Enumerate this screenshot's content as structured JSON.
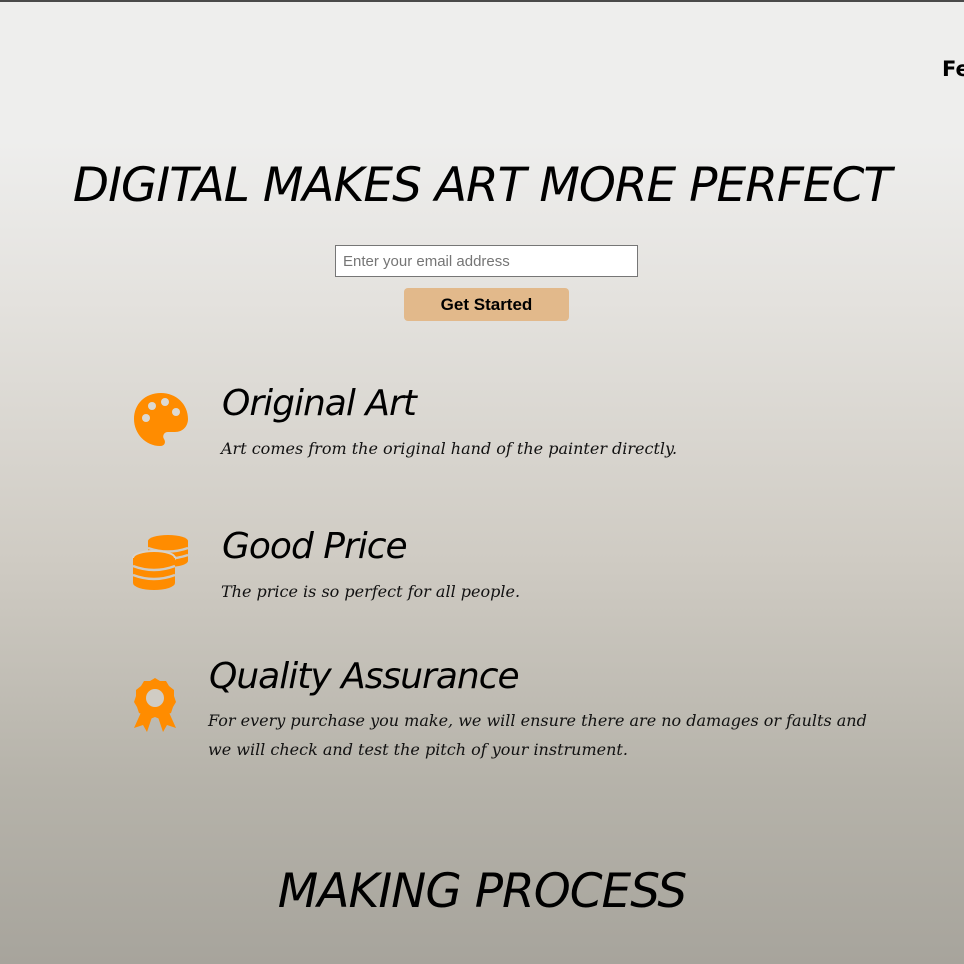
{
  "nav": {
    "features_label": "Fe"
  },
  "hero": {
    "title": "DIGITAL MAKES ART MORE PERFECT",
    "email_placeholder": "Enter your email address",
    "cta_label": "Get Started"
  },
  "features": [
    {
      "icon": "palette-icon",
      "title": "Original Art",
      "description": "Art comes from the original hand of the painter directly."
    },
    {
      "icon": "coins-icon",
      "title": "Good Price",
      "description": "The price is so perfect for all people."
    },
    {
      "icon": "award-icon",
      "title": "Quality Assurance",
      "description": "For every purchase you make, we will ensure there are no damages or faults and we will check and test the pitch of your instrument."
    }
  ],
  "process": {
    "title": "MAKING PROCESS"
  },
  "colors": {
    "accent": "#ff8c00",
    "button": "#e2b98b",
    "header_bg": "#eeeeed"
  }
}
